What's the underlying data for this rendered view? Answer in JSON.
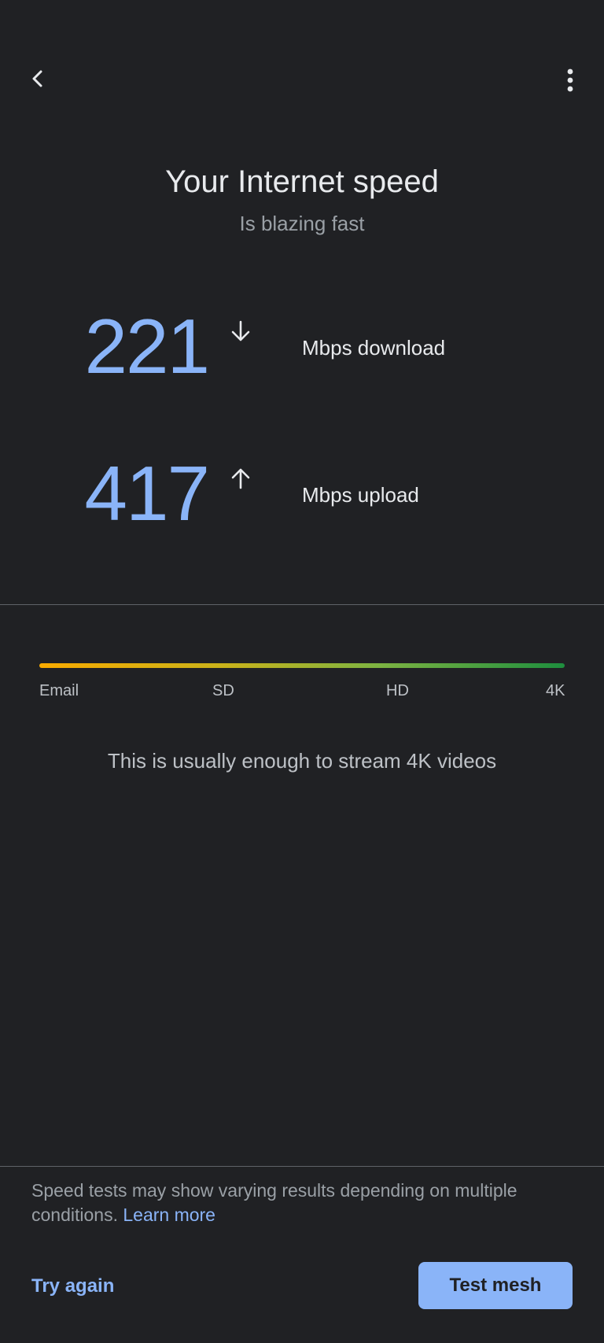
{
  "header": {
    "back_icon": "chevron-left-icon",
    "more_icon": "more-vert-icon"
  },
  "summary": {
    "title": "Your Internet speed",
    "subtitle": "Is blazing fast"
  },
  "download": {
    "value": "221",
    "unit_label": "Mbps download",
    "icon": "arrow-down-icon"
  },
  "upload": {
    "value": "417",
    "unit_label": "Mbps upload",
    "icon": "arrow-up-icon"
  },
  "quality_scale": {
    "labels": [
      "Email",
      "SD",
      "HD",
      "4K"
    ],
    "gradient_colors": [
      "#f9ab00",
      "#1e8e3e"
    ],
    "note": "This is usually enough to stream 4K videos"
  },
  "footer": {
    "disclaimer": "Speed tests may show varying results depending on multiple conditions.",
    "learn_more": "Learn more",
    "try_again": "Try again",
    "test_mesh": "Test mesh"
  },
  "colors": {
    "background": "#202124",
    "accent": "#8ab4f8",
    "text_primary": "#e8eaed",
    "text_secondary": "#9aa0a6"
  }
}
